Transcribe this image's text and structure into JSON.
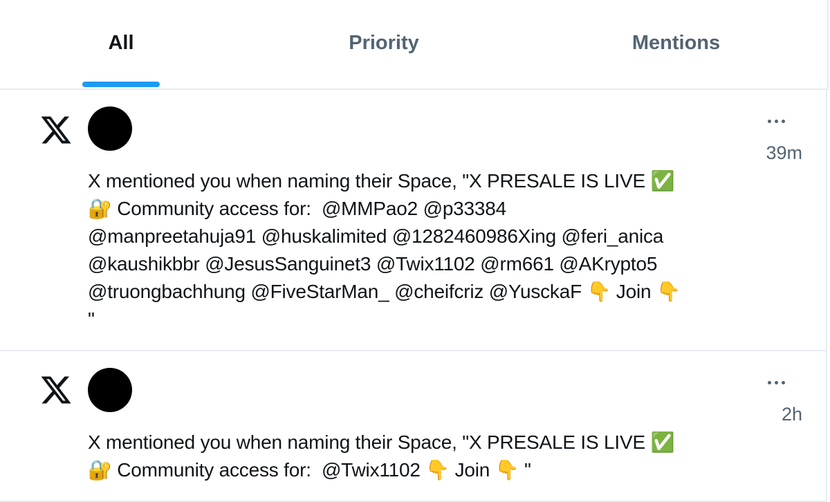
{
  "tabs": [
    {
      "label": "All",
      "active": true
    },
    {
      "label": "Priority",
      "active": false
    },
    {
      "label": "Mentions",
      "active": false
    }
  ],
  "accent_color": "#1d9bf0",
  "notifications": [
    {
      "icon": "x-logo-icon",
      "avatar": "avatar-black",
      "time": "39m",
      "text": "X mentioned you when naming their Space, \"X PRESALE IS LIVE ✅\n🔐 Community access for:  @MMPao2 @p33384\n@manpreetahuja91 @huskalimited @1282460986Xing @feri_anica\n@kaushikbbr @JesusSanguinet3 @Twix1102 @rm661 @AKrypto5\n@truongbachhung @FiveStarMan_ @cheifcriz @YusckaF 👇 Join 👇\n\""
    },
    {
      "icon": "x-logo-icon",
      "avatar": "avatar-black",
      "time": "2h",
      "text": "X mentioned you when naming their Space, \"X PRESALE IS LIVE ✅\n🔐 Community access for:  @Twix1102 👇 Join 👇 \""
    }
  ]
}
